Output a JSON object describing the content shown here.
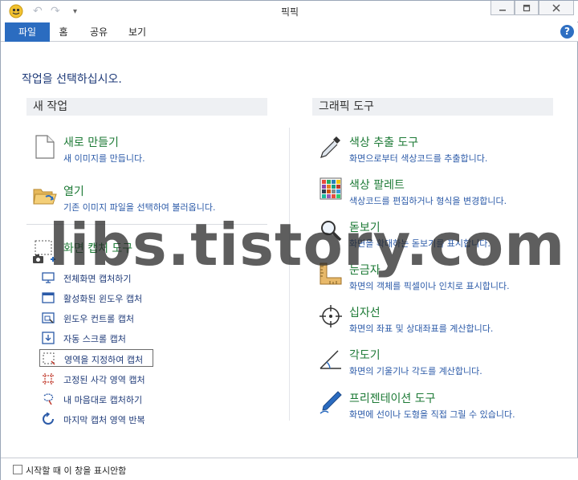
{
  "window": {
    "title": "픽픽"
  },
  "ribbon": {
    "tabs": [
      {
        "label": "파일",
        "active": true
      },
      {
        "label": "홈"
      },
      {
        "label": "공유"
      },
      {
        "label": "보기"
      }
    ],
    "help": "?"
  },
  "prompt": "작업을 선택하십시오.",
  "new_task": {
    "heading": "새 작업",
    "items": [
      {
        "title": "새로 만들기",
        "desc": "새 이미지를 만듭니다.",
        "icon": "new-document-icon"
      },
      {
        "title": "열기",
        "desc": "기존 이미지 파일을 선택하여 불러옵니다.",
        "icon": "open-folder-icon"
      }
    ],
    "capture": {
      "title": "화면 캡처 도구",
      "icon": "screen-capture-icon",
      "items": [
        {
          "label": "전체화면 캡처하기",
          "icon": "monitor-icon"
        },
        {
          "label": "활성화된 윈도우 캡처",
          "icon": "window-icon"
        },
        {
          "label": "윈도우 컨트롤 캡처",
          "icon": "window-control-icon"
        },
        {
          "label": "자동 스크롤 캡처",
          "icon": "scroll-capture-icon"
        },
        {
          "label": "영역을 지정하여 캡처",
          "icon": "region-icon",
          "selected": true
        },
        {
          "label": "고정된 사각 영역 캡처",
          "icon": "fixed-region-icon"
        },
        {
          "label": "내 마음대로 캡처하기",
          "icon": "freehand-icon"
        },
        {
          "label": "마지막 캡처 영역 반복",
          "icon": "repeat-icon"
        }
      ]
    }
  },
  "graphic_tools": {
    "heading": "그래픽 도구",
    "items": [
      {
        "title": "색상 추출 도구",
        "desc": "화면으로부터 색상코드를 추출합니다.",
        "icon": "eyedropper-icon"
      },
      {
        "title": "색상 팔레트",
        "desc": "색상코드를 편집하거나 형식을 변경합니다.",
        "icon": "palette-icon"
      },
      {
        "title": "돋보기",
        "desc": "화면을 확대하는 돋보기를 표시합니다.",
        "icon": "magnifier-icon"
      },
      {
        "title": "눈금자",
        "desc": "화면의 객체를 픽셀이나 인치로 표시합니다.",
        "icon": "ruler-icon"
      },
      {
        "title": "십자선",
        "desc": "화면의 좌표 및 상대좌표를 계산합니다.",
        "icon": "crosshair-icon"
      },
      {
        "title": "각도기",
        "desc": "화면의 기울기나 각도를 계산합니다.",
        "icon": "protractor-icon"
      },
      {
        "title": "프리젠테이션 도구",
        "desc": "화면에 선이나 도형을 직접 그릴 수 있습니다.",
        "icon": "pen-icon"
      }
    ]
  },
  "footer": {
    "checkbox_label": "시작할 때 이 창을 표시안함",
    "checked": false
  },
  "watermark": "libs.tistory.com"
}
